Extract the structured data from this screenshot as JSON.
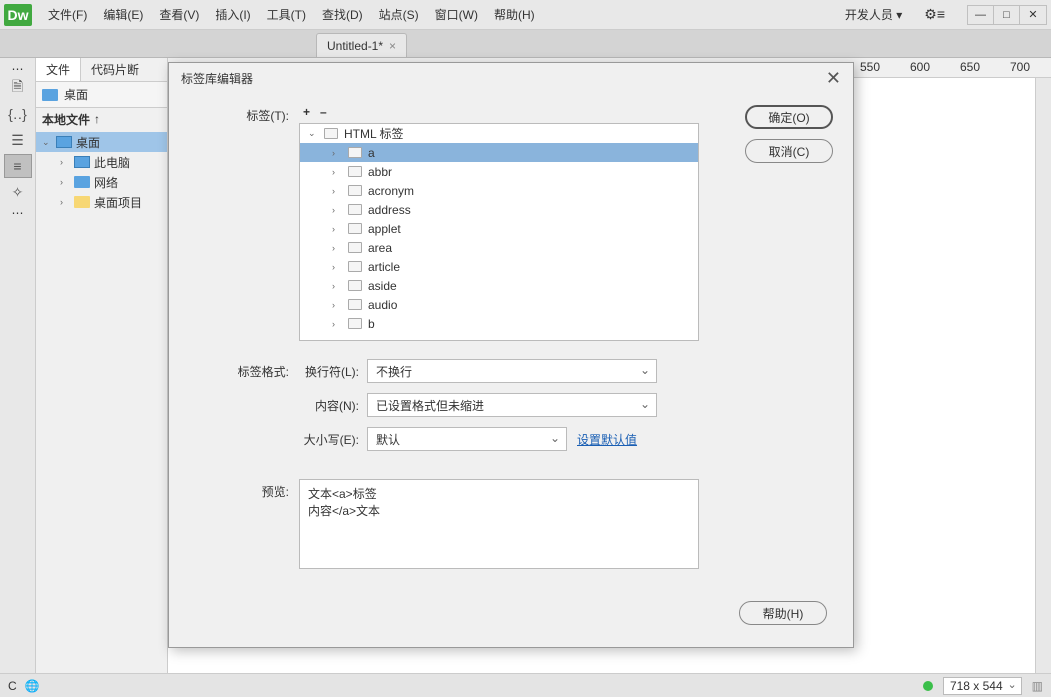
{
  "menubar": {
    "logo": "Dw",
    "items": [
      "文件(F)",
      "编辑(E)",
      "查看(V)",
      "插入(I)",
      "工具(T)",
      "查找(D)",
      "站点(S)",
      "窗口(W)",
      "帮助(H)"
    ],
    "dev_label": "开发人员",
    "gear": "⚙≡"
  },
  "doc_tab": {
    "title": "Untitled-1*"
  },
  "files_panel": {
    "tabs": [
      "文件",
      "代码片断"
    ],
    "site": "桌面",
    "local_header": "本地文件",
    "tree": [
      {
        "label": "桌面",
        "icon": "monitor",
        "depth": 0,
        "expanded": true,
        "selected": true
      },
      {
        "label": "此电脑",
        "icon": "monitor",
        "depth": 1,
        "expanded": false
      },
      {
        "label": "网络",
        "icon": "folder-blue",
        "depth": 1,
        "expanded": false
      },
      {
        "label": "桌面项目",
        "icon": "folder-yellow",
        "depth": 1,
        "expanded": false
      }
    ]
  },
  "ruler_marks": [
    550,
    600,
    650,
    700
  ],
  "dialog": {
    "title": "标签库编辑器",
    "labels": {
      "tags": "标签(T):",
      "format": "标签格式:",
      "preview": "预览:",
      "linebreak": "换行符(L):",
      "content": "内容(N):",
      "case": "大小写(E):"
    },
    "buttons": {
      "ok": "确定(O)",
      "cancel": "取消(C)",
      "help": "帮助(H)"
    },
    "tree_root": "HTML 标签",
    "tags_list": [
      "a",
      "abbr",
      "acronym",
      "address",
      "applet",
      "area",
      "article",
      "aside",
      "audio",
      "b"
    ],
    "selected_tag": "a",
    "linebreak_value": "不换行",
    "content_value": "已设置格式但未缩进",
    "case_value": "默认",
    "reset_link": "设置默认值",
    "preview_line1": "文本<a>标签",
    "preview_line2": "内容</a>文本"
  },
  "statusbar": {
    "dimensions": "718 x 544"
  }
}
